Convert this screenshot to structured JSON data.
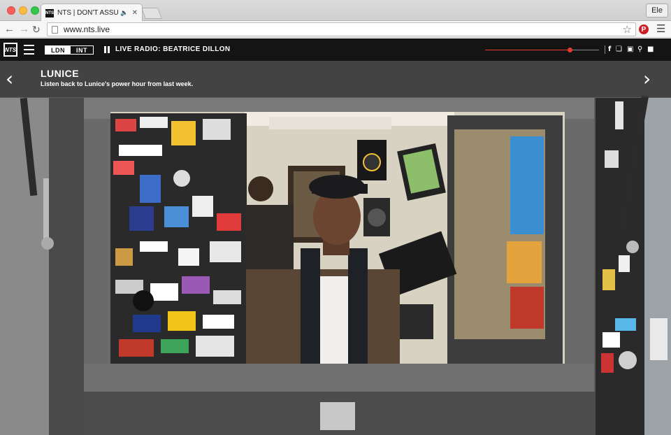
{
  "browser": {
    "tab_title": "NTS | DON'T ASSUME",
    "tab_favicon": "NTS",
    "profile": "Ele",
    "url": "www.nts.live"
  },
  "site": {
    "logo": "NTS",
    "stations": [
      "LDN",
      "INT"
    ],
    "active_station": "LDN",
    "live_label": "LIVE RADIO: BEATRICE DILLON",
    "volume_level": 0.74,
    "accent_color": "#e63b2e",
    "social_icons": [
      "facebook-icon",
      "twitter-icon",
      "instagram-icon",
      "search-icon",
      "chat-icon"
    ]
  },
  "feature": {
    "title": "LUNICE",
    "subtitle": "Listen back to Lunice's power hour from last week."
  }
}
